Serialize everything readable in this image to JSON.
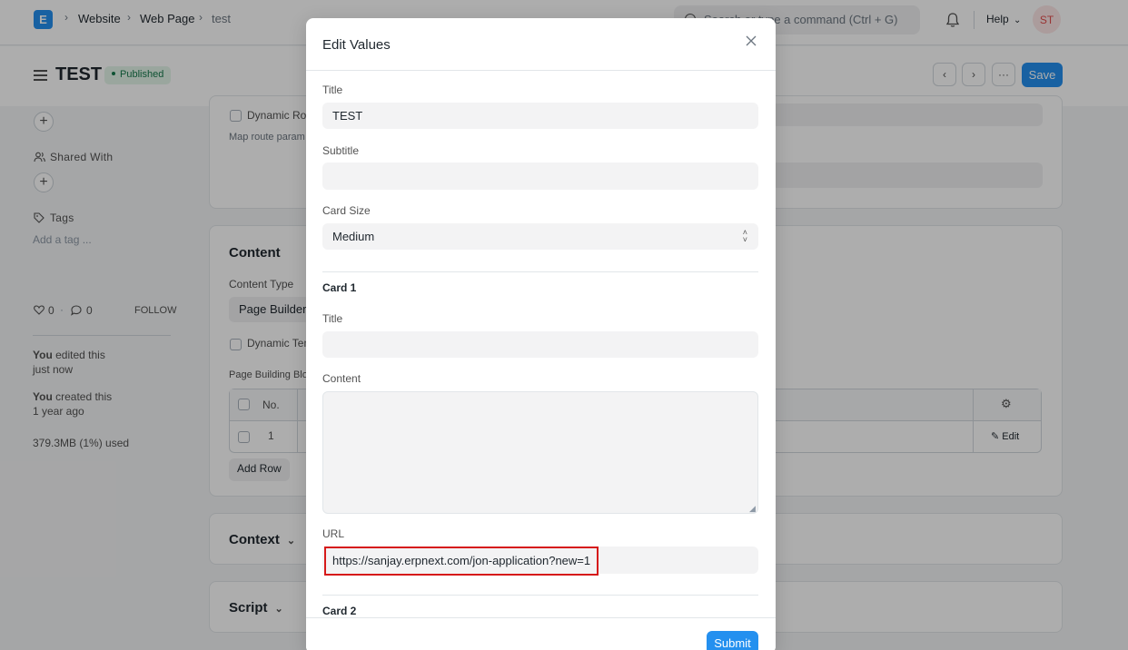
{
  "navbar": {
    "logo_letter": "E",
    "breadcrumbs": [
      "Website",
      "Web Page",
      "test"
    ],
    "search_placeholder": "Search or type a command (Ctrl + G)",
    "help_label": "Help",
    "avatar_initials": "ST"
  },
  "page": {
    "title": "TEST",
    "status": "Published",
    "save_label": "Save",
    "more_label": "···"
  },
  "sidebar": {
    "shared_with_label": "Shared With",
    "tags_label": "Tags",
    "add_tag_placeholder": "Add a tag ...",
    "likes": "0",
    "comments": "0",
    "follow_label": "FOLLOW",
    "activity": [
      {
        "actor": "You",
        "action": " edited this",
        "when": "just now"
      },
      {
        "actor": "You",
        "action": " created this",
        "when": "1 year ago"
      }
    ],
    "storage": "379.3MB (1%) used"
  },
  "main": {
    "dynamic_route_label": "Dynamic Rou",
    "map_route_text": "Map route param",
    "content_title": "Content",
    "content_type_label": "Content Type",
    "content_type_value": "Page Builder",
    "dynamic_template_label": "Dynamic Tem",
    "page_blocks_label": "Page Building Blo",
    "table_header_no": "No.",
    "row_no": "1",
    "edit_label": "Edit",
    "add_row_label": "Add Row",
    "context_title": "Context",
    "script_title": "Script"
  },
  "modal": {
    "title": "Edit Values",
    "title_label": "Title",
    "title_value": "TEST",
    "subtitle_label": "Subtitle",
    "subtitle_value": "",
    "card_size_label": "Card Size",
    "card_size_value": "Medium",
    "card1_heading": "Card 1",
    "card1_title_label": "Title",
    "card1_title_value": "",
    "card1_content_label": "Content",
    "card1_content_value": "",
    "card1_url_label": "URL",
    "card1_url_value": "https://sanjay.erpnext.com/jon-application?new=1",
    "card2_heading": "Card 2",
    "submit_label": "Submit"
  }
}
